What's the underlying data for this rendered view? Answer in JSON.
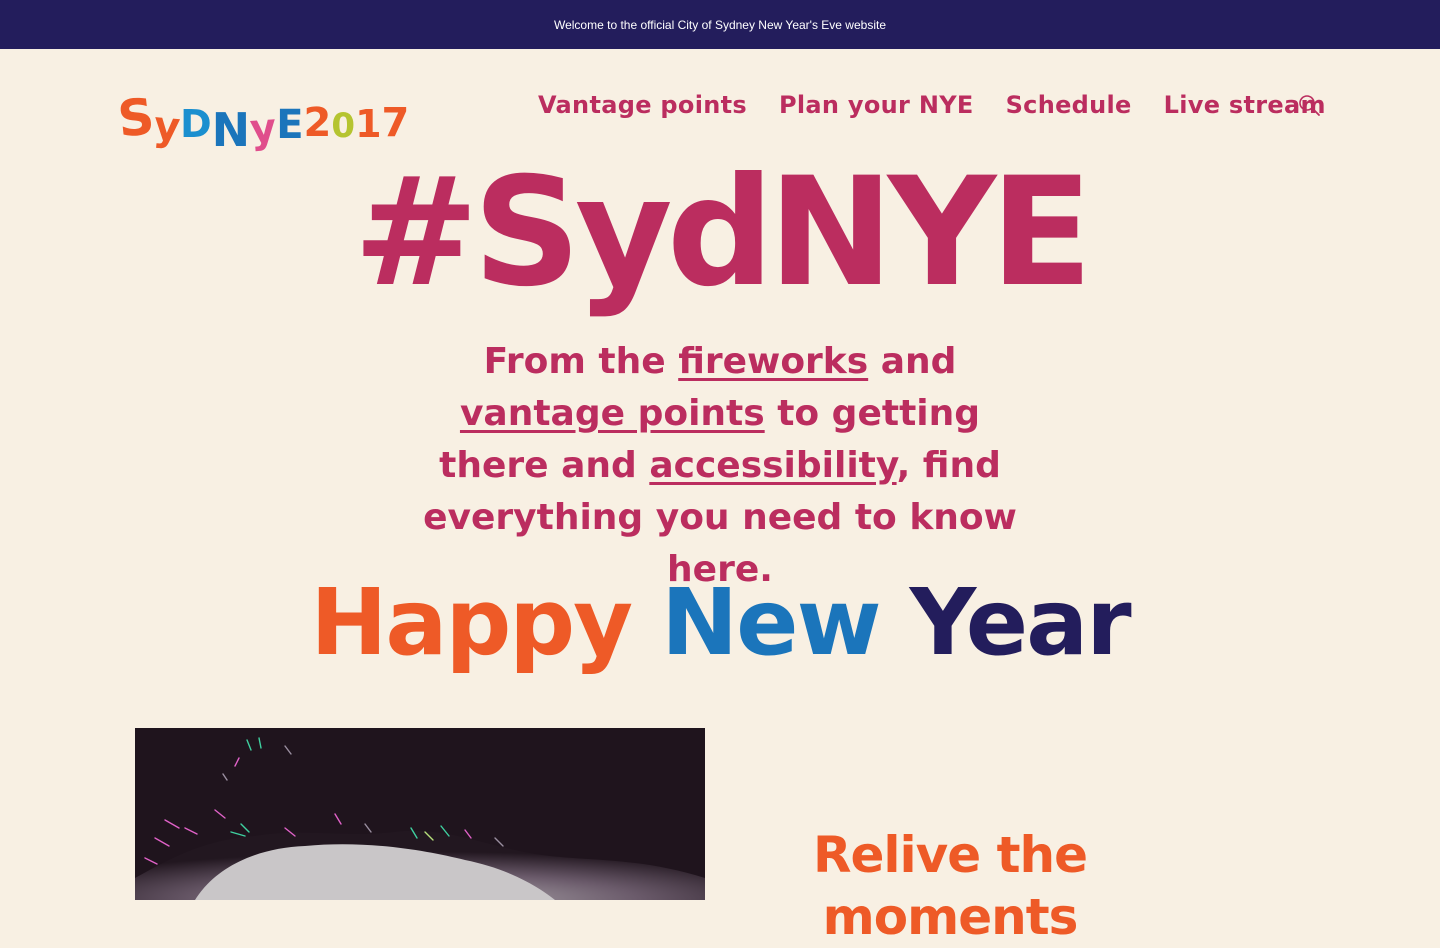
{
  "top_banner": {
    "text": "Welcome to the official City of Sydney New Year's Eve website"
  },
  "header": {
    "logo": {
      "letters": [
        "S",
        "y",
        "D",
        "N",
        "y",
        "E",
        "2",
        "0",
        "1",
        "7"
      ]
    },
    "nav": [
      {
        "label": "Vantage points"
      },
      {
        "label": "Plan your NYE"
      },
      {
        "label": "Schedule"
      },
      {
        "label": "Live stream"
      }
    ],
    "search_icon": "search-icon"
  },
  "hero": {
    "title": "#SydNYE",
    "intro": {
      "p1": "From the ",
      "link_fireworks": "fireworks",
      "p2": " and ",
      "link_vantage": "vantage points",
      "p3": " to getting there and ",
      "link_accessibility": "accessibility",
      "p4": ", find everything you need to know here."
    }
  },
  "greeting": {
    "w1": "Happy",
    "w2": "New",
    "w3": "Year"
  },
  "feature": {
    "image_alt": "fireworks-photo",
    "heading": "Relive the moments"
  },
  "colors": {
    "navy": "#231d5c",
    "magenta": "#bb2d5f",
    "orange": "#ee5a27",
    "blue": "#1b75bb",
    "cream": "#f8f0e3"
  }
}
